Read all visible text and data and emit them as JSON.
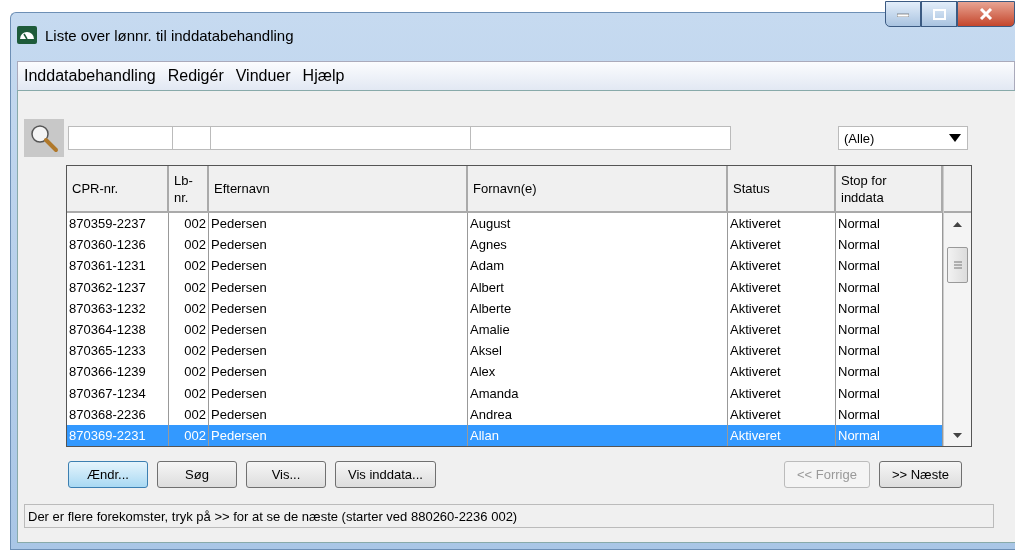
{
  "window": {
    "title": "Liste over lønnr. til inddatabehandling"
  },
  "menu": [
    {
      "label": "Inddatabehandling"
    },
    {
      "label": "Redigér"
    },
    {
      "label": "Vinduer"
    },
    {
      "label": "Hjælp"
    }
  ],
  "filter": {
    "status": "(Alle)"
  },
  "table": {
    "columns": [
      "CPR-nr.",
      "Lb-nr.",
      "Efternavn",
      "Fornavn(e)",
      "Status",
      "Stop for inddata"
    ],
    "rows": [
      {
        "cells": [
          "870359-2237",
          "002",
          "Pedersen",
          "August",
          "Aktiveret",
          "Normal"
        ],
        "selected": false
      },
      {
        "cells": [
          "870360-1236",
          "002",
          "Pedersen",
          "Agnes",
          "Aktiveret",
          "Normal"
        ],
        "selected": false
      },
      {
        "cells": [
          "870361-1231",
          "002",
          "Pedersen",
          "Adam",
          "Aktiveret",
          "Normal"
        ],
        "selected": false
      },
      {
        "cells": [
          "870362-1237",
          "002",
          "Pedersen",
          "Albert",
          "Aktiveret",
          "Normal"
        ],
        "selected": false
      },
      {
        "cells": [
          "870363-1232",
          "002",
          "Pedersen",
          "Alberte",
          "Aktiveret",
          "Normal"
        ],
        "selected": false
      },
      {
        "cells": [
          "870364-1238",
          "002",
          "Pedersen",
          "Amalie",
          "Aktiveret",
          "Normal"
        ],
        "selected": false
      },
      {
        "cells": [
          "870365-1233",
          "002",
          "Pedersen",
          "Aksel",
          "Aktiveret",
          "Normal"
        ],
        "selected": false
      },
      {
        "cells": [
          "870366-1239",
          "002",
          "Pedersen",
          "Alex",
          "Aktiveret",
          "Normal"
        ],
        "selected": false
      },
      {
        "cells": [
          "870367-1234",
          "002",
          "Pedersen",
          "Amanda",
          "Aktiveret",
          "Normal"
        ],
        "selected": false
      },
      {
        "cells": [
          "870368-2236",
          "002",
          "Pedersen",
          "Andrea",
          "Aktiveret",
          "Normal"
        ],
        "selected": false
      },
      {
        "cells": [
          "870369-2231",
          "002",
          "Pedersen",
          "Allan",
          "Aktiveret",
          "Normal"
        ],
        "selected": true
      }
    ]
  },
  "buttons": [
    {
      "label": "Ændr...",
      "focused": true,
      "disabled": false
    },
    {
      "label": "Søg",
      "focused": false,
      "disabled": false
    },
    {
      "label": "Vis...",
      "focused": false,
      "disabled": false
    },
    {
      "label": "Vis inddata...",
      "focused": false,
      "disabled": false
    }
  ],
  "nav_buttons": [
    {
      "label": "<< Forrige",
      "focused": false,
      "disabled": true
    },
    {
      "label": ">> Næste",
      "focused": false,
      "disabled": false
    }
  ],
  "status_bar": "Der er flere forekomster, tryk på >> for at se de næste (starter ved 880260-2236 002)"
}
